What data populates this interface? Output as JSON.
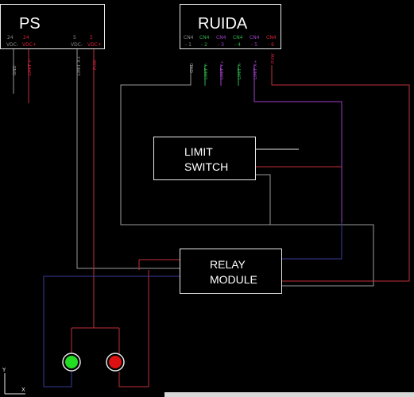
{
  "colors": {
    "background": "#000000",
    "box_stroke": "#e8e8e8",
    "wire_gray": "#9a9a9a",
    "wire_red": "#c0303a",
    "wire_purple": "#a040c8",
    "wire_blue": "#3a3a9c",
    "pin_green": "#2fb24a",
    "pin_red": "#d8203a",
    "pin_gray": "#8a8a8a",
    "lamp_green": "#22dd22",
    "lamp_red": "#dd1111"
  },
  "ps": {
    "title": "PS",
    "pins": [
      {
        "num": "24",
        "name": "VDC-",
        "color": "#8a8a8a"
      },
      {
        "num": "24",
        "name": "VDC+",
        "color": "#d8203a"
      },
      {
        "num": "5",
        "name": "VDC-",
        "color": "#8a8a8a"
      },
      {
        "num": "5",
        "name": "VDC+",
        "color": "#d8203a"
      }
    ],
    "wire_labels": [
      "GND",
      "LIMIT Y-",
      "LIMIT X+",
      "PUW"
    ]
  },
  "ruida": {
    "title": "RUIDA",
    "pins": [
      {
        "num": "CN4",
        "name": "- 1",
        "color": "#8a8a8a"
      },
      {
        "num": "CN4",
        "name": "- 2",
        "color": "#2fb24a"
      },
      {
        "num": "CN4",
        "name": "- 3",
        "color": "#a040c8"
      },
      {
        "num": "CN4",
        "name": "- 4",
        "color": "#2fb24a"
      },
      {
        "num": "CN4",
        "name": "- 5",
        "color": "#a040c8"
      },
      {
        "num": "CN4",
        "name": "- 6",
        "color": "#d8203a"
      }
    ],
    "wire_labels": [
      "GND",
      "LIMIT Y-",
      "LIMIT Y+",
      "LIMIT X-",
      "LIMIT X+",
      "PUW"
    ]
  },
  "limit_switch": {
    "line1": "LIMIT",
    "line2": "SWITCH"
  },
  "relay_module": {
    "line1": "RELAY",
    "line2": "MODULE"
  },
  "ucs": {
    "y_label": "Y",
    "x_label": "X"
  }
}
